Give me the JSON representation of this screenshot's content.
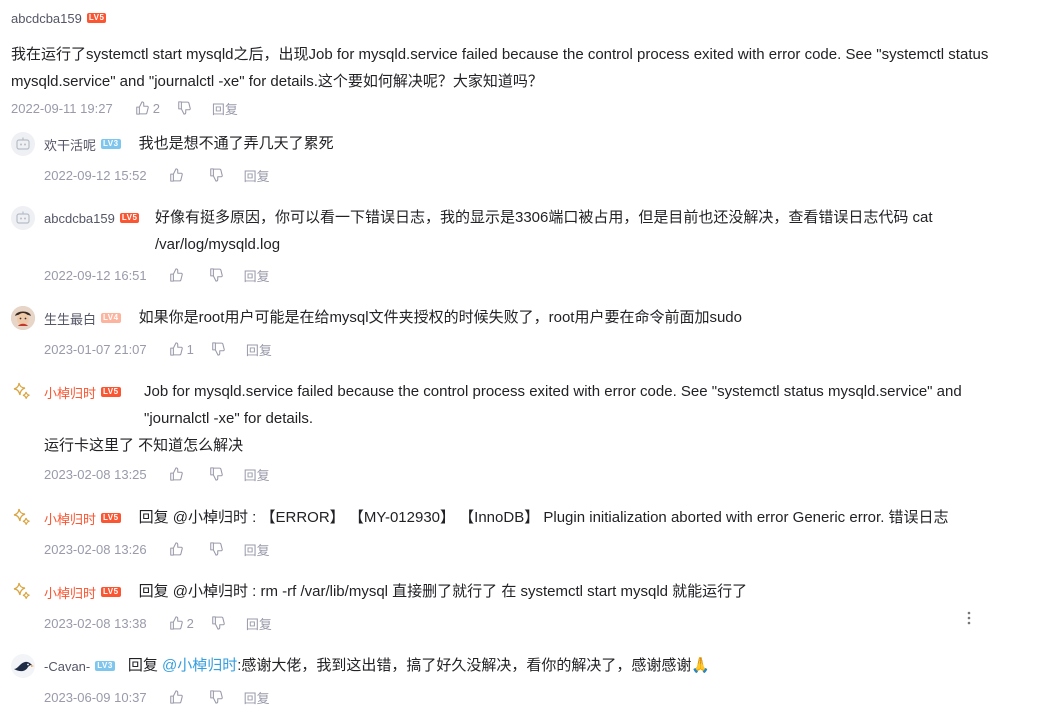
{
  "main": {
    "user": "abcdcba159",
    "level": "LV5",
    "text": "我在运行了systemctl start mysqld之后，出现Job for mysqld.service failed because the control process exited with error code. See \"systemctl status mysqld.service\" and \"journalctl -xe\" for details.这个要如何解决呢？大家知道吗？",
    "time": "2022-09-11 19:27",
    "likes": "2",
    "reply_label": "回复"
  },
  "replies": [
    {
      "user": "欢干活呢",
      "level": "LV3",
      "avatar": "default-avatar-icon",
      "text": "我也是想不通了弄几天了累死",
      "time": "2022-09-12 15:52",
      "likes": "",
      "reply_label": "回复"
    },
    {
      "user": "abcdcba159",
      "level": "LV5",
      "avatar": "default-avatar-icon",
      "text": "好像有挺多原因，你可以看一下错误日志，我的显示是3306端口被占用，但是目前也还没解决，查看错误日志代码 cat /var/log/mysqld.log",
      "time": "2022-09-12 16:51",
      "likes": "",
      "reply_label": "回复"
    },
    {
      "user": "生生最白",
      "level": "LV4",
      "avatar": "photo-avatar",
      "text": "如果你是root用户可能是在给mysql文件夹授权的时候失败了，root用户要在命令前面加sudo",
      "time": "2023-01-07 21:07",
      "likes": "1",
      "reply_label": "回复"
    },
    {
      "user": "小棹归时",
      "level": "LV5",
      "avatar": "sparkle-avatar",
      "text": "Job for mysqld.service failed because the control process exited with error code. See \"systemctl status mysqld.service\" and \"journalctl -xe\" for details.",
      "text2": "运行卡这里了 不知道怎么解决",
      "time": "2023-02-08 13:25",
      "likes": "",
      "reply_label": "回复"
    },
    {
      "user": "小棹归时",
      "level": "LV5",
      "avatar": "sparkle-avatar",
      "text": "回复 @小棹归时 : 【ERROR】 【MY-012930】 【InnoDB】 Plugin initialization aborted with error Generic error.  错误日志",
      "time": "2023-02-08 13:26",
      "likes": "",
      "reply_label": "回复"
    },
    {
      "user": "小棹归时",
      "level": "LV5",
      "avatar": "sparkle-avatar",
      "text": "回复 @小棹归时 : rm -rf /var/lib/mysql  直接删了就行了 在 systemctl start mysqld  就能运行了",
      "time": "2023-02-08 13:38",
      "likes": "2",
      "reply_label": "回复"
    },
    {
      "user": "-Cavan-",
      "level": "LV3",
      "avatar": "bird-avatar",
      "reply_prefix": "回复",
      "mention": "@小棹归时",
      "text": ":感谢大佬，我到这出错，搞了好久没解决，看你的解决了，感谢感谢🙏",
      "time": "2023-06-09 10:37",
      "likes": "",
      "reply_label": "回复"
    }
  ],
  "more_icon": "more-vertical-icon",
  "colors": {
    "name_red": "#fc5531",
    "meta_grey": "#999aaa",
    "mention_blue": "#349edf",
    "lv_orange": "#fc5531",
    "lv_blue": "#7fc6ef"
  }
}
